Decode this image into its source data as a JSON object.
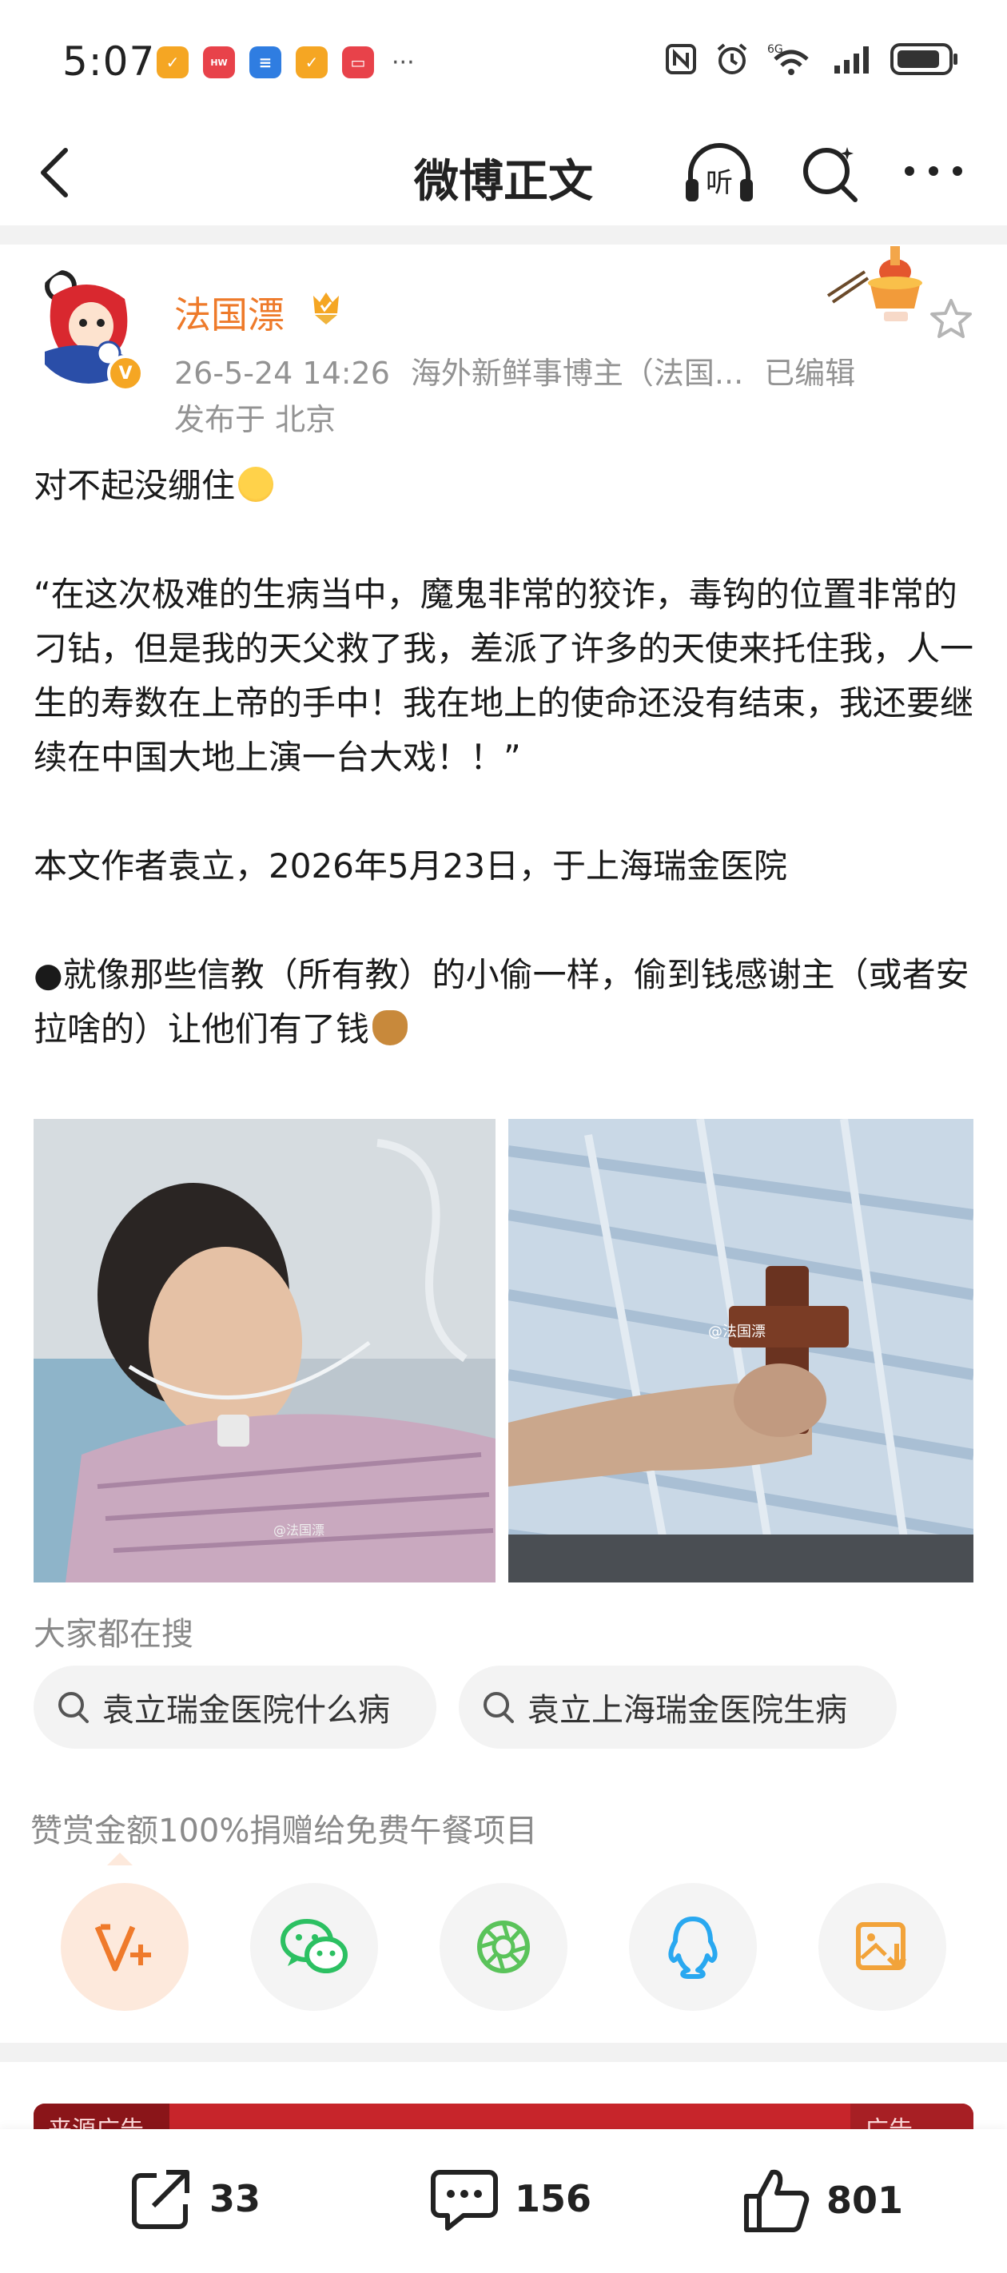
{
  "status_bar": {
    "time": "5:07",
    "more": "···",
    "network": "6G",
    "app_badges": [
      {
        "icon": "app-orange-icon",
        "color": "#f5a623"
      },
      {
        "icon": "huawei-app-icon",
        "color": "#e8424a"
      },
      {
        "icon": "app-blue-icon",
        "color": "#2f7de1"
      },
      {
        "icon": "app-orange-icon",
        "color": "#f5a623"
      },
      {
        "icon": "app-red-icon",
        "color": "#e8424a"
      }
    ]
  },
  "nav": {
    "title": "微博正文",
    "listen_label": "听"
  },
  "author": {
    "name": "法国漂",
    "date": "26-5-24 14:26",
    "tag": "海外新鲜事博主（法国...",
    "edited": "已编辑",
    "location": "发布于 北京"
  },
  "post": {
    "line1": "对不起没绷住",
    "quote": "“在这次极难的生病当中，魔鬼非常的狡诈，毒钩的位置非常的刁钻，但是我的天父救了我，差派了许多的天使来托住我，人一生的寿数在上帝的手中！我在地上的使命还没有结束，我还要继续在中国大地上演一台大戏！！”",
    "source": "本文作者袁立，2026年5月23日，于上海瑞金医院",
    "comment": "●就像那些信教（所有教）的小偷一样，偷到钱感谢主（或者安拉啥的）让他们有了钱",
    "image_watermark": "@法国漂"
  },
  "search": {
    "heading": "大家都在搜",
    "chips": [
      "袁立瑞金医院什么病",
      "袁立上海瑞金医院生病"
    ]
  },
  "reward": {
    "note": "赞赏金额100%捐赠给免费午餐项目"
  },
  "ad": {
    "label": "来源广告",
    "tag": "广告"
  },
  "actions": {
    "share_count": "33",
    "comment_count": "156",
    "like_count": "801"
  },
  "colors": {
    "accent": "#ee7a2a",
    "meta": "#939393",
    "wechat": "#2cc062",
    "moments": "#5ac35a",
    "qq": "#29a8f0",
    "save": "#f2a33a"
  }
}
